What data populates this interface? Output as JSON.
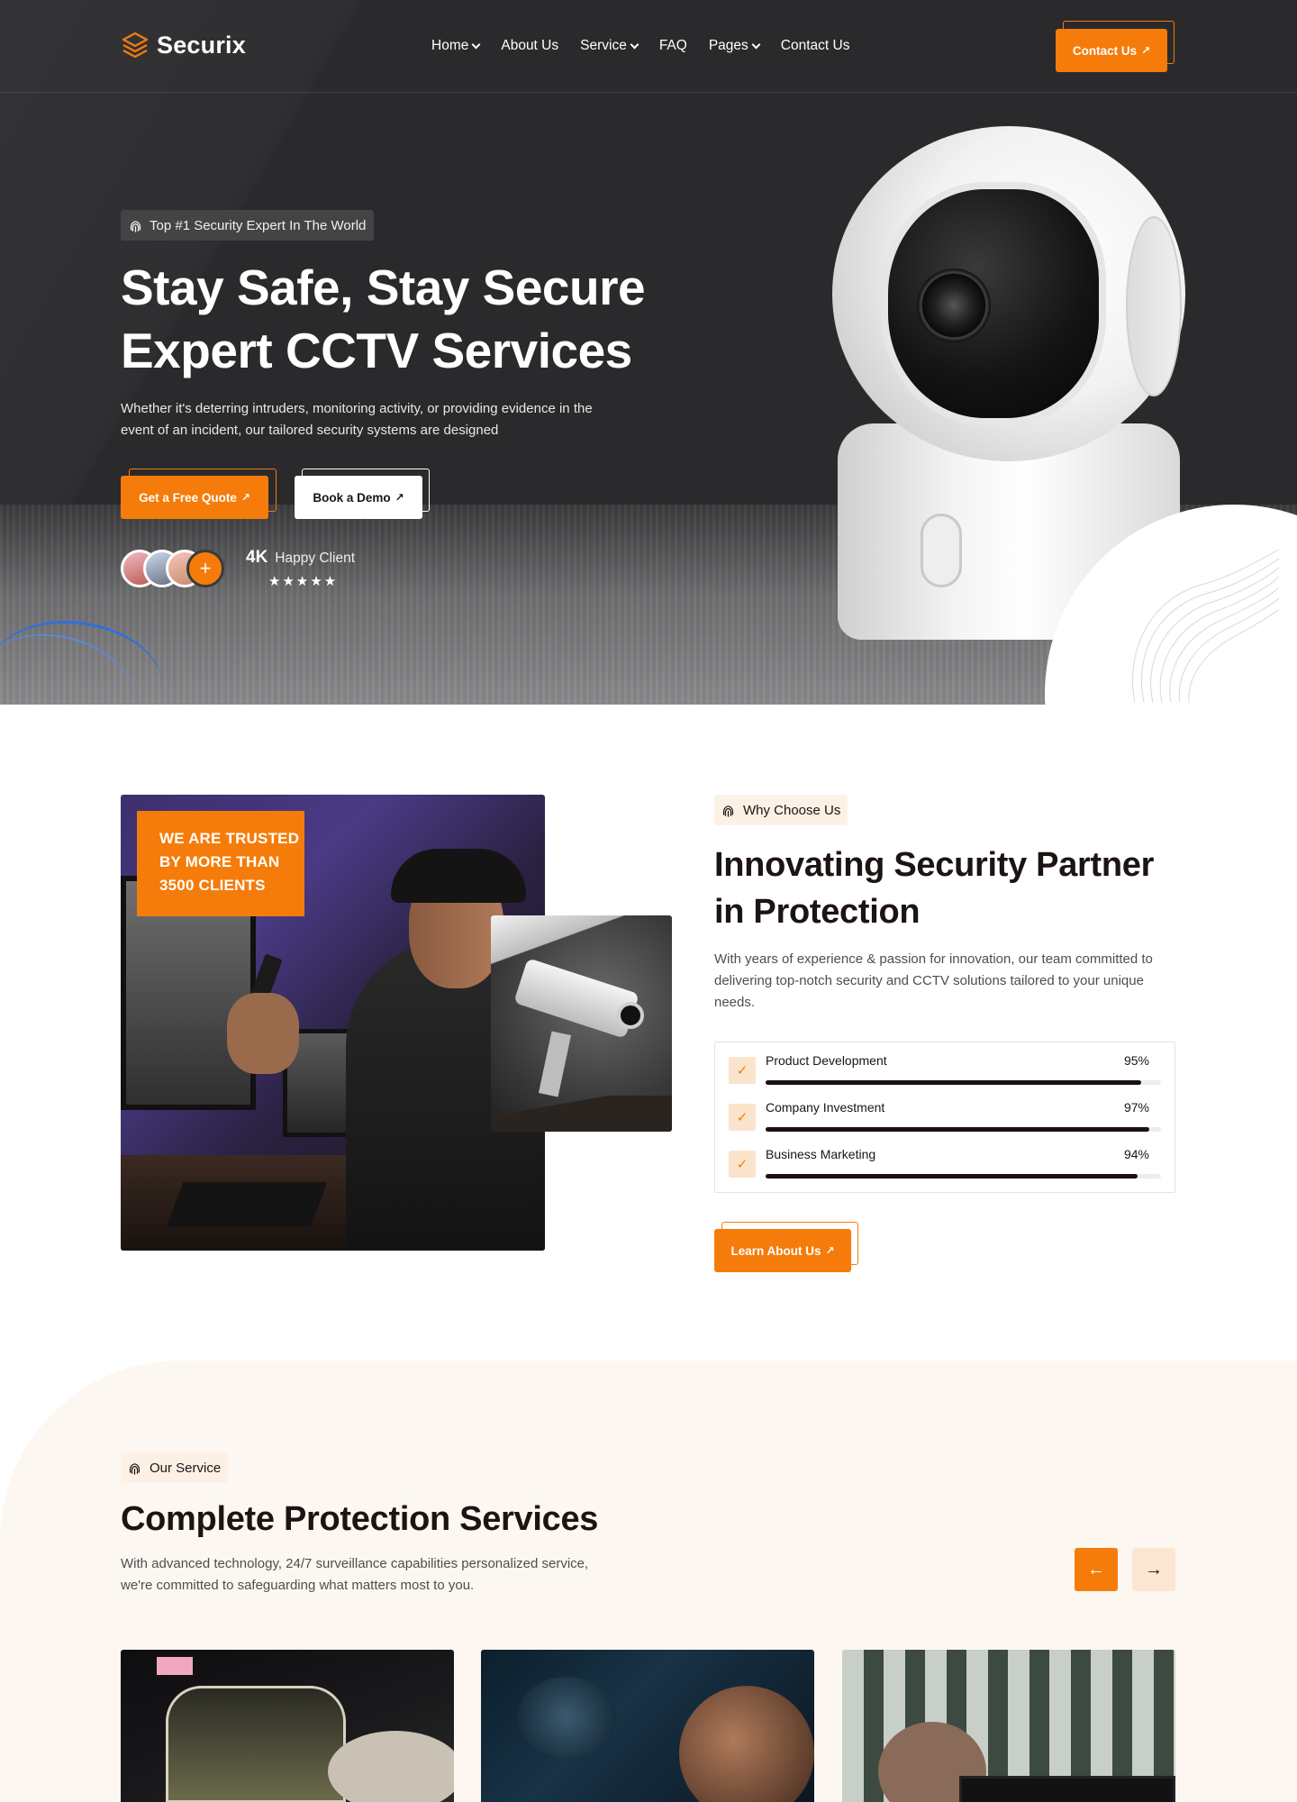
{
  "brand": {
    "name": "Securix",
    "accent": "#f57c0a",
    "dark": "#2a2a2c",
    "cream": "#fdf7f1"
  },
  "nav": {
    "items": [
      {
        "label": "Home",
        "dropdown": true
      },
      {
        "label": "About Us",
        "dropdown": false
      },
      {
        "label": "Service",
        "dropdown": true
      },
      {
        "label": "FAQ",
        "dropdown": false
      },
      {
        "label": "Pages",
        "dropdown": true
      },
      {
        "label": "Contact Us",
        "dropdown": false
      }
    ],
    "cta": "Contact Us"
  },
  "hero": {
    "badge": "Top #1 Security Expert In The World",
    "title_line1": "Stay Safe, Stay Secure",
    "title_line2": "Expert CCTV Services",
    "description": "Whether it's deterring intruders, monitoring activity, or providing evidence in the event of an incident, our tailored security systems are designed",
    "primary_button": "Get a Free Quote",
    "secondary_button": "Book a Demo",
    "clients_count": "4K",
    "clients_label": "Happy Client",
    "rating_stars": 5,
    "stars_text": "★★★★★",
    "avatar_plus": "+"
  },
  "about": {
    "trusted_text": "WE ARE TRUSTED BY MORE THAN 3500 CLIENTS",
    "badge": "Why Choose Us",
    "title_line1": "Innovating Security Partner",
    "title_line2": "in Protection",
    "description": "With years of experience & passion for innovation, our team committed to delivering top-notch security and CCTV solutions tailored to your unique needs.",
    "skills": [
      {
        "name": "Product Development",
        "percent": "95%",
        "value": 95
      },
      {
        "name": "Company Investment",
        "percent": "97%",
        "value": 97
      },
      {
        "name": "Business Marketing",
        "percent": "94%",
        "value": 94
      }
    ],
    "button": "Learn About Us"
  },
  "services": {
    "badge": "Our Service",
    "title": "Complete Protection Services",
    "description": "With advanced technology, 24/7 surveillance capabilities personalized service, we're committed to safeguarding what matters most to you.",
    "prev_icon": "arrow-left-icon",
    "next_icon": "arrow-right-icon"
  }
}
